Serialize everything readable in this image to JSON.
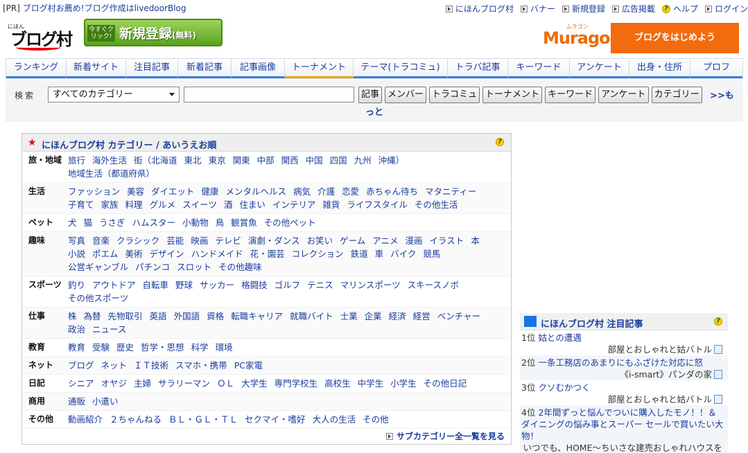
{
  "top": {
    "pr_tag": "[PR]",
    "pr_text": "ブログ村お薦め!ブログ作成はlivedoorBlog",
    "links": [
      {
        "label": "にほんブログ村",
        "icon": "arrow-icon"
      },
      {
        "label": "バナー",
        "icon": "arrow-icon"
      },
      {
        "label": "新規登録",
        "icon": "arrow-icon"
      },
      {
        "label": "広告掲載",
        "icon": "arrow-icon"
      },
      {
        "label": "ヘルプ",
        "icon": "help-icon"
      },
      {
        "label": "ログイン",
        "icon": "arrow-icon"
      }
    ]
  },
  "header": {
    "logo_small": "にほん",
    "logo_text": "ブログ村",
    "register_now": "今すぐクリック!",
    "register_main": "新規登録",
    "register_sub": "(無料)",
    "muragon_kana": "ムラゴン",
    "muragon_name": "Muragon",
    "start_button": "ブログをはじめよう"
  },
  "nav": {
    "tabs": [
      "ランキング",
      "新着サイト",
      "注目記事",
      "新着記事",
      "記事画像",
      "トーナメント",
      "テーマ(トラコミュ)",
      "トラバ記事",
      "キーワード",
      "アンケート",
      "出身・住所",
      "プロフ"
    ]
  },
  "search": {
    "label": "検索",
    "select_value": "すべてのカテゴリー",
    "input_value": "",
    "buttons": [
      "記事",
      "メンバー",
      "トラコミュ",
      "トーナメント",
      "キーワード",
      "アンケート",
      "カテゴリー"
    ],
    "more_1": ">>も",
    "more_2": "っと"
  },
  "categories": {
    "title": "にほんブログ村 カテゴリー / あいうえお順",
    "rows": [
      {
        "cat": "旅・地域",
        "items": [
          "旅行",
          "海外生活",
          "街（北海道",
          "東北",
          "東京",
          "関東",
          "中部",
          "関西",
          "中国",
          "四国",
          "九州",
          "沖縄）",
          "地域生活（都道府県）"
        ]
      },
      {
        "cat": "生活",
        "items": [
          "ファッション",
          "美容",
          "ダイエット",
          "健康",
          "メンタルヘルス",
          "病気",
          "介護",
          "恋愛",
          "赤ちゃん待ち",
          "マタニティー",
          "子育て",
          "家族",
          "料理",
          "グルメ",
          "スイーツ",
          "酒",
          "住まい",
          "インテリア",
          "雑貨",
          "ライフスタイル",
          "その他生活"
        ]
      },
      {
        "cat": "ペット",
        "items": [
          "犬",
          "猫",
          "うさぎ",
          "ハムスター",
          "小動物",
          "鳥",
          "観賞魚",
          "その他ペット"
        ]
      },
      {
        "cat": "趣味",
        "items": [
          "写真",
          "音楽",
          "クラシック",
          "芸能",
          "映画",
          "テレビ",
          "演劇・ダンス",
          "お笑い",
          "ゲーム",
          "アニメ",
          "漫画",
          "イラスト",
          "本",
          "小説",
          "ポエム",
          "美術",
          "デザイン",
          "ハンドメイド",
          "花・園芸",
          "コレクション",
          "鉄道",
          "車",
          "バイク",
          "競馬",
          "公営ギャンブル",
          "パチンコ",
          "スロット",
          "その他趣味"
        ]
      },
      {
        "cat": "スポーツ",
        "items": [
          "釣り",
          "アウトドア",
          "自転車",
          "野球",
          "サッカー",
          "格闘技",
          "ゴルフ",
          "テニス",
          "マリンスポーツ",
          "スキースノボ",
          "その他スポーツ"
        ]
      },
      {
        "cat": "仕事",
        "items": [
          "株",
          "為替",
          "先物取引",
          "英語",
          "外国語",
          "資格",
          "転職キャリア",
          "就職バイト",
          "士業",
          "企業",
          "経済",
          "経営",
          "ベンチャー",
          "政治",
          "ニュース"
        ]
      },
      {
        "cat": "教育",
        "items": [
          "教育",
          "受験",
          "歴史",
          "哲学・思想",
          "科学",
          "環境"
        ]
      },
      {
        "cat": "ネット",
        "items": [
          "ブログ",
          "ネット",
          "ＩＴ技術",
          "スマホ・携帯",
          "PC家電"
        ]
      },
      {
        "cat": "日記",
        "items": [
          "シニア",
          "オヤジ",
          "主婦",
          "サラリーマン",
          "ＯＬ",
          "大学生",
          "専門学校生",
          "高校生",
          "中学生",
          "小学生",
          "その他日記"
        ]
      },
      {
        "cat": "商用",
        "items": [
          "通販",
          "小遣い"
        ]
      },
      {
        "cat": "その他",
        "items": [
          "動画紹介",
          "２ちゃんねる",
          "ＢＬ・ＧＬ・ＴＬ",
          "セクマイ・嗜好",
          "大人の生活",
          "その他"
        ]
      }
    ],
    "subcat_link": "サブカテゴリー全一覧を見る"
  },
  "attention": {
    "title": "にほんブログ村 注目記事",
    "items": [
      {
        "rank": "1位",
        "title": "姑との遭遇",
        "blog": "部屋とおしゃれと姑バトル"
      },
      {
        "rank": "2位",
        "title": "一条工務店のあまりにもふざけた対応に怒",
        "blog": "《i-smart》パンダの家"
      },
      {
        "rank": "3位",
        "title": "クソむかつく",
        "blog": "部屋とおしゃれと姑バトル"
      },
      {
        "rank": "4位",
        "title": "2年間ずっと悩んでついに購入したモノ！！＆ ダイニングの悩み事とスーパー セールで買いたい大物！",
        "blog": "いつでも、HOME〜ちいさな建売おしゃれハウスを"
      }
    ]
  },
  "colors": {
    "link": "#1a3c9e",
    "accent_orange": "#f26b0f",
    "nav_underline": "#3b7fd6",
    "register_green": "#5aa21f"
  }
}
